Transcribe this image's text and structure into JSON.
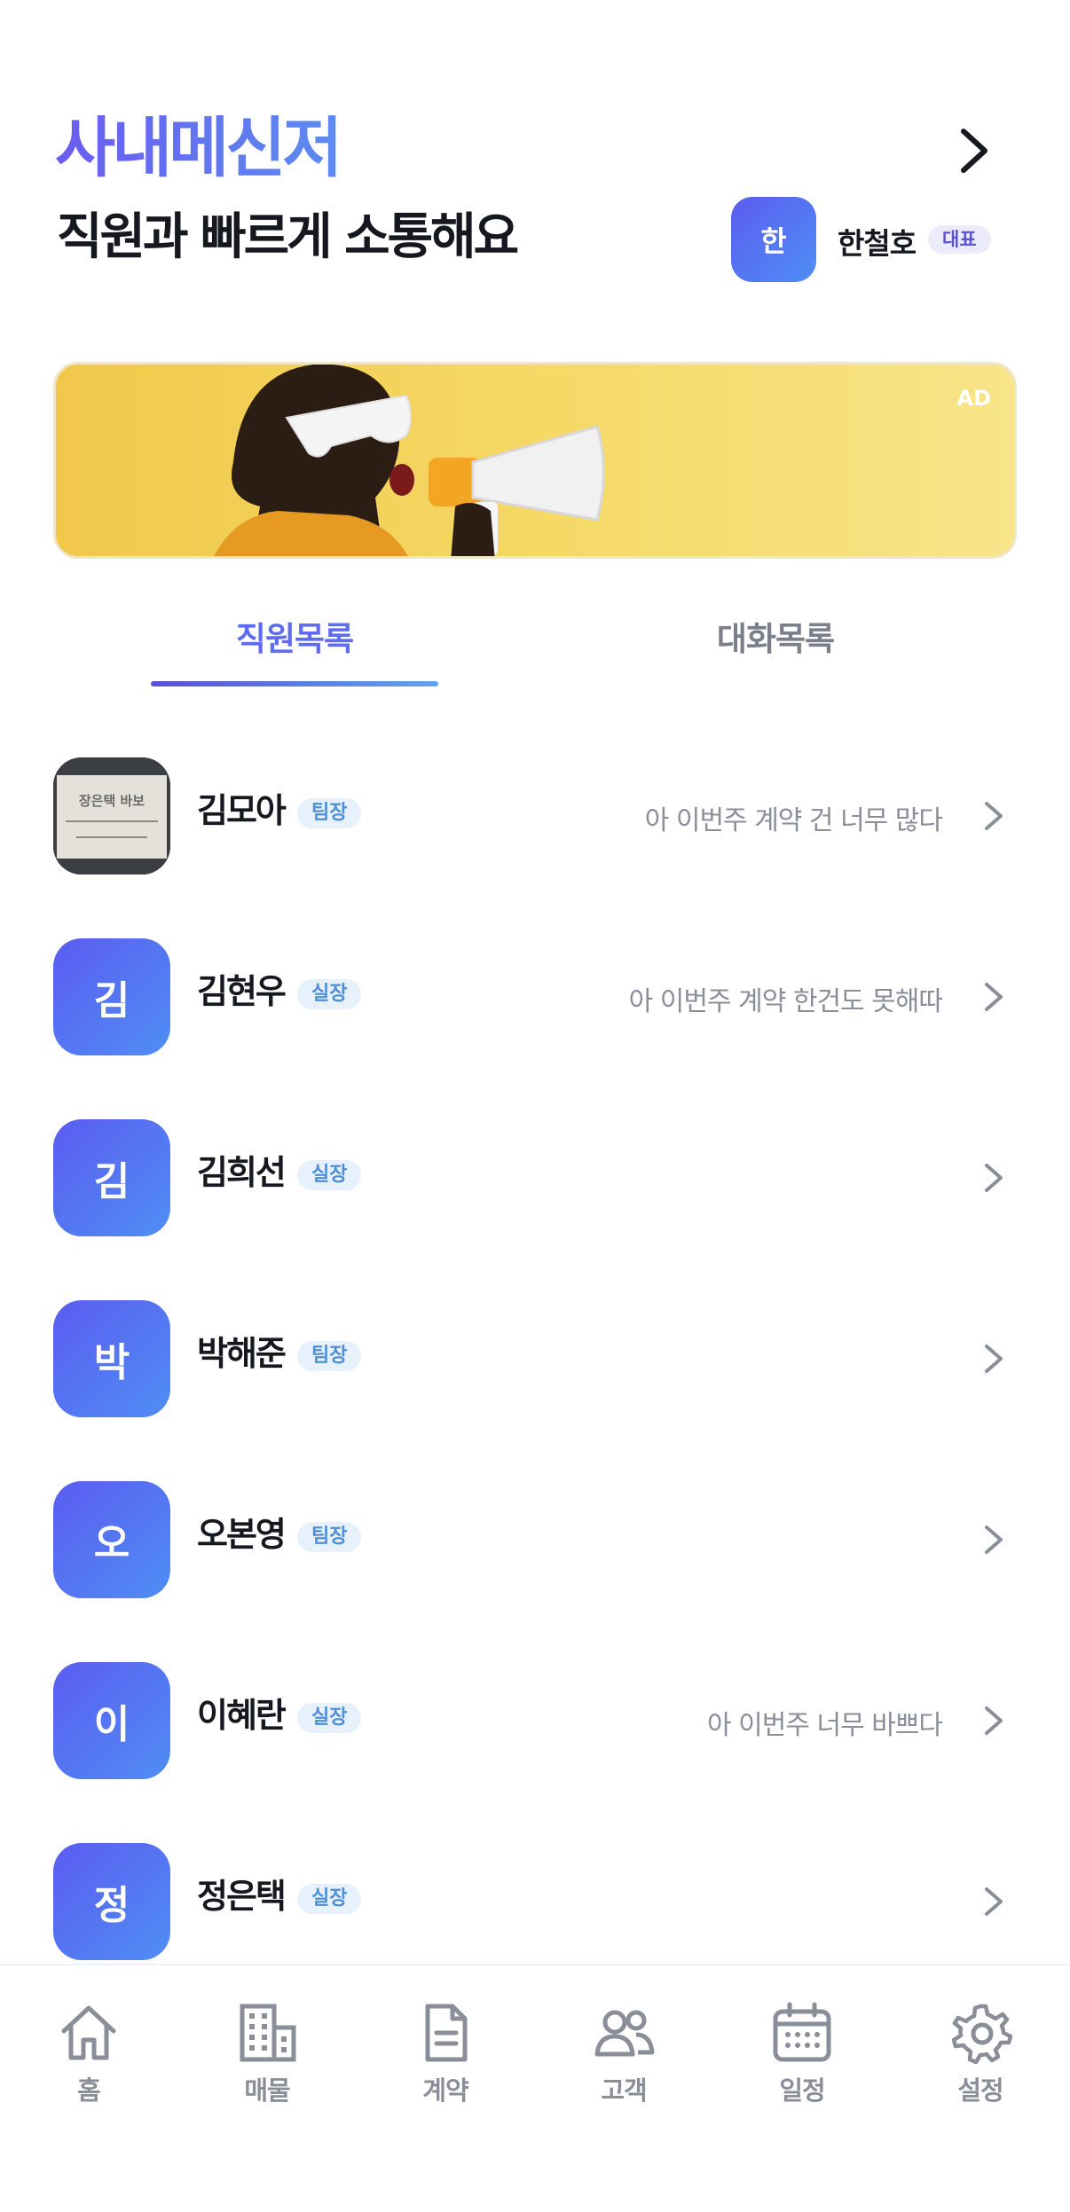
{
  "header": {
    "title": "사내메신저",
    "subtitle": "직원과 빠르게 소통해요",
    "user": {
      "initial": "한",
      "name": "한철호",
      "role": "대표"
    }
  },
  "ad": {
    "label": "AD"
  },
  "tabs": [
    {
      "label": "직원목록",
      "active": true
    },
    {
      "label": "대화목록",
      "active": false
    }
  ],
  "employees": [
    {
      "name": "김모아",
      "initial": "",
      "role": "팀장",
      "preview": "아 이번주 계약 건 너무 많다",
      "avatar_photo_text": [
        "장은택 바보",
        "...",
        "..."
      ]
    },
    {
      "name": "김현우",
      "initial": "김",
      "role": "실장",
      "preview": "아 이번주 계약 한건도 못해따"
    },
    {
      "name": "김희선",
      "initial": "김",
      "role": "실장",
      "preview": ""
    },
    {
      "name": "박해준",
      "initial": "박",
      "role": "팀장",
      "preview": ""
    },
    {
      "name": "오본영",
      "initial": "오",
      "role": "팀장",
      "preview": ""
    },
    {
      "name": "이혜란",
      "initial": "이",
      "role": "실장",
      "preview": "아 이번주 너무 바쁘다"
    },
    {
      "name": "정은택",
      "initial": "정",
      "role": "실장",
      "preview": ""
    }
  ],
  "bottom_nav": [
    {
      "label": "홈",
      "icon": "home-icon"
    },
    {
      "label": "매물",
      "icon": "building-icon"
    },
    {
      "label": "계약",
      "icon": "document-icon"
    },
    {
      "label": "고객",
      "icon": "users-icon"
    },
    {
      "label": "일정",
      "icon": "calendar-icon"
    },
    {
      "label": "설정",
      "icon": "gear-icon"
    }
  ],
  "colors": {
    "accent": "#5f6bf0",
    "avatar_gradient_start": "#5b5cf0",
    "avatar_gradient_end": "#4f8ef5",
    "badge_bg": "#e7f1fb"
  }
}
